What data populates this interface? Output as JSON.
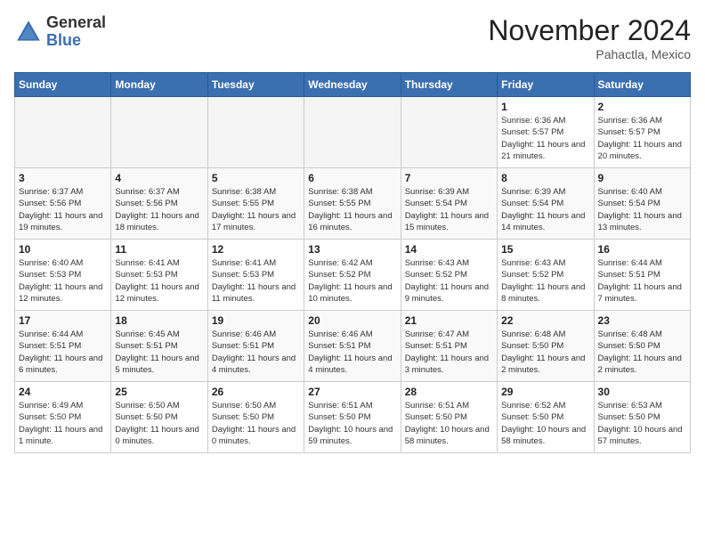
{
  "header": {
    "logo_general": "General",
    "logo_blue": "Blue",
    "month_title": "November 2024",
    "location": "Pahactla, Mexico"
  },
  "calendar": {
    "days_of_week": [
      "Sunday",
      "Monday",
      "Tuesday",
      "Wednesday",
      "Thursday",
      "Friday",
      "Saturday"
    ],
    "weeks": [
      [
        {
          "day": "",
          "info": ""
        },
        {
          "day": "",
          "info": ""
        },
        {
          "day": "",
          "info": ""
        },
        {
          "day": "",
          "info": ""
        },
        {
          "day": "",
          "info": ""
        },
        {
          "day": "1",
          "info": "Sunrise: 6:36 AM\nSunset: 5:57 PM\nDaylight: 11 hours and 21 minutes."
        },
        {
          "day": "2",
          "info": "Sunrise: 6:36 AM\nSunset: 5:57 PM\nDaylight: 11 hours and 20 minutes."
        }
      ],
      [
        {
          "day": "3",
          "info": "Sunrise: 6:37 AM\nSunset: 5:56 PM\nDaylight: 11 hours and 19 minutes."
        },
        {
          "day": "4",
          "info": "Sunrise: 6:37 AM\nSunset: 5:56 PM\nDaylight: 11 hours and 18 minutes."
        },
        {
          "day": "5",
          "info": "Sunrise: 6:38 AM\nSunset: 5:55 PM\nDaylight: 11 hours and 17 minutes."
        },
        {
          "day": "6",
          "info": "Sunrise: 6:38 AM\nSunset: 5:55 PM\nDaylight: 11 hours and 16 minutes."
        },
        {
          "day": "7",
          "info": "Sunrise: 6:39 AM\nSunset: 5:54 PM\nDaylight: 11 hours and 15 minutes."
        },
        {
          "day": "8",
          "info": "Sunrise: 6:39 AM\nSunset: 5:54 PM\nDaylight: 11 hours and 14 minutes."
        },
        {
          "day": "9",
          "info": "Sunrise: 6:40 AM\nSunset: 5:54 PM\nDaylight: 11 hours and 13 minutes."
        }
      ],
      [
        {
          "day": "10",
          "info": "Sunrise: 6:40 AM\nSunset: 5:53 PM\nDaylight: 11 hours and 12 minutes."
        },
        {
          "day": "11",
          "info": "Sunrise: 6:41 AM\nSunset: 5:53 PM\nDaylight: 11 hours and 12 minutes."
        },
        {
          "day": "12",
          "info": "Sunrise: 6:41 AM\nSunset: 5:53 PM\nDaylight: 11 hours and 11 minutes."
        },
        {
          "day": "13",
          "info": "Sunrise: 6:42 AM\nSunset: 5:52 PM\nDaylight: 11 hours and 10 minutes."
        },
        {
          "day": "14",
          "info": "Sunrise: 6:43 AM\nSunset: 5:52 PM\nDaylight: 11 hours and 9 minutes."
        },
        {
          "day": "15",
          "info": "Sunrise: 6:43 AM\nSunset: 5:52 PM\nDaylight: 11 hours and 8 minutes."
        },
        {
          "day": "16",
          "info": "Sunrise: 6:44 AM\nSunset: 5:51 PM\nDaylight: 11 hours and 7 minutes."
        }
      ],
      [
        {
          "day": "17",
          "info": "Sunrise: 6:44 AM\nSunset: 5:51 PM\nDaylight: 11 hours and 6 minutes."
        },
        {
          "day": "18",
          "info": "Sunrise: 6:45 AM\nSunset: 5:51 PM\nDaylight: 11 hours and 5 minutes."
        },
        {
          "day": "19",
          "info": "Sunrise: 6:46 AM\nSunset: 5:51 PM\nDaylight: 11 hours and 4 minutes."
        },
        {
          "day": "20",
          "info": "Sunrise: 6:46 AM\nSunset: 5:51 PM\nDaylight: 11 hours and 4 minutes."
        },
        {
          "day": "21",
          "info": "Sunrise: 6:47 AM\nSunset: 5:51 PM\nDaylight: 11 hours and 3 minutes."
        },
        {
          "day": "22",
          "info": "Sunrise: 6:48 AM\nSunset: 5:50 PM\nDaylight: 11 hours and 2 minutes."
        },
        {
          "day": "23",
          "info": "Sunrise: 6:48 AM\nSunset: 5:50 PM\nDaylight: 11 hours and 2 minutes."
        }
      ],
      [
        {
          "day": "24",
          "info": "Sunrise: 6:49 AM\nSunset: 5:50 PM\nDaylight: 11 hours and 1 minute."
        },
        {
          "day": "25",
          "info": "Sunrise: 6:50 AM\nSunset: 5:50 PM\nDaylight: 11 hours and 0 minutes."
        },
        {
          "day": "26",
          "info": "Sunrise: 6:50 AM\nSunset: 5:50 PM\nDaylight: 11 hours and 0 minutes."
        },
        {
          "day": "27",
          "info": "Sunrise: 6:51 AM\nSunset: 5:50 PM\nDaylight: 10 hours and 59 minutes."
        },
        {
          "day": "28",
          "info": "Sunrise: 6:51 AM\nSunset: 5:50 PM\nDaylight: 10 hours and 58 minutes."
        },
        {
          "day": "29",
          "info": "Sunrise: 6:52 AM\nSunset: 5:50 PM\nDaylight: 10 hours and 58 minutes."
        },
        {
          "day": "30",
          "info": "Sunrise: 6:53 AM\nSunset: 5:50 PM\nDaylight: 10 hours and 57 minutes."
        }
      ]
    ]
  }
}
